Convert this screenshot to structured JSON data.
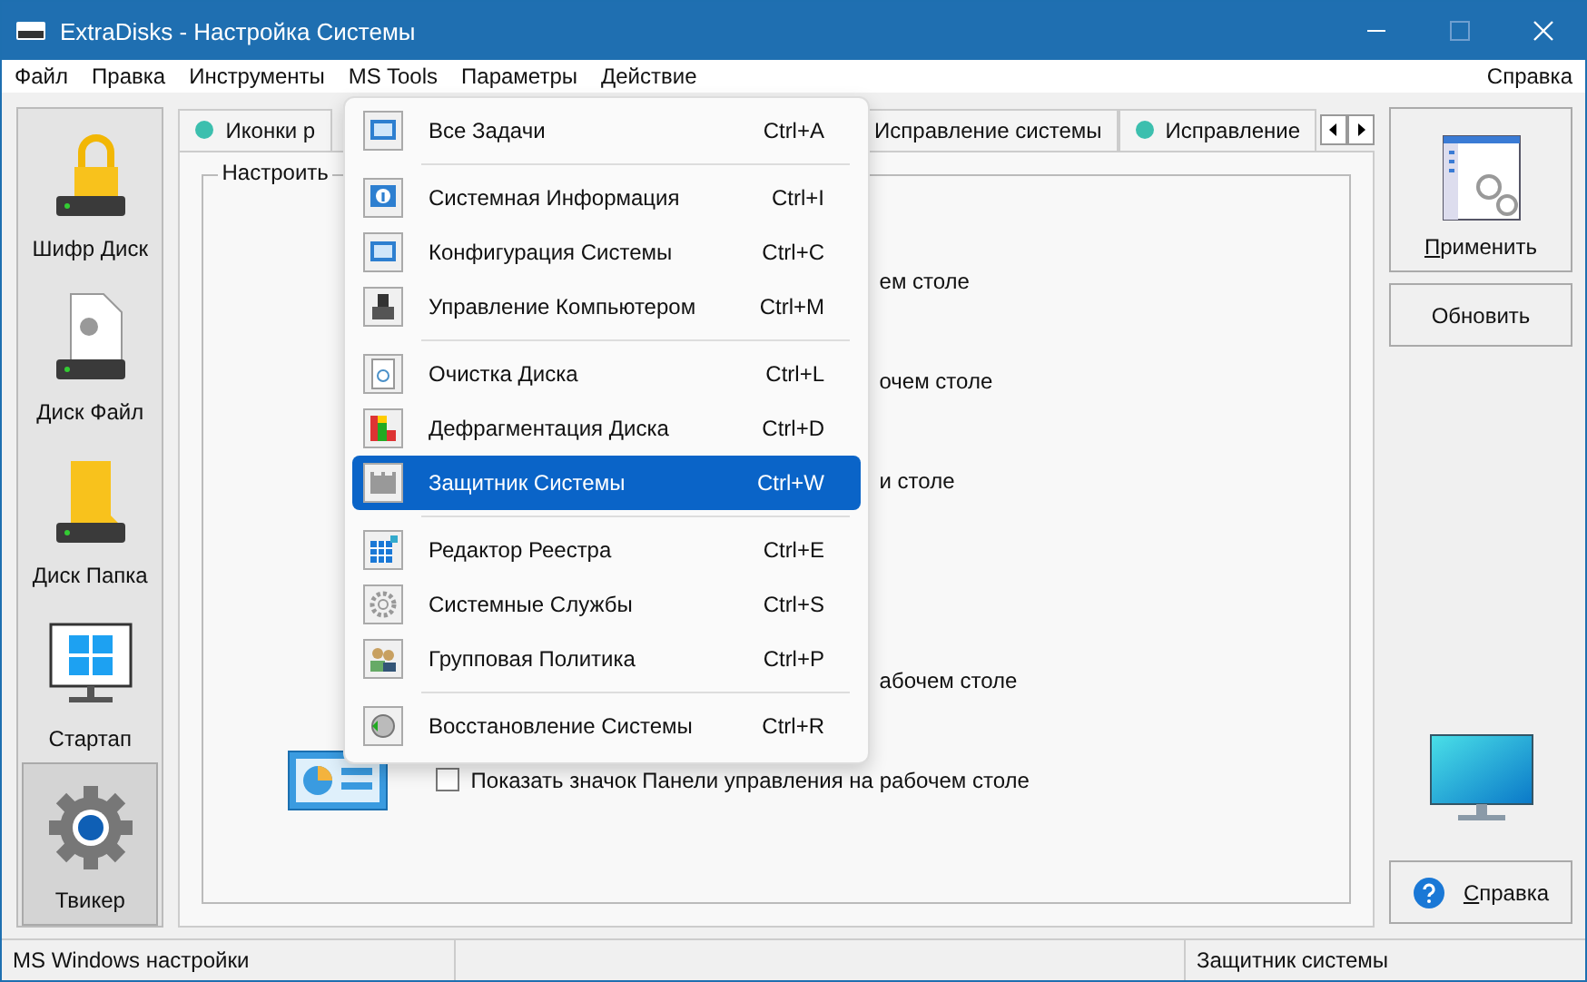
{
  "window": {
    "title": "ExtraDisks - Настройка Системы"
  },
  "menu_bar": {
    "items": [
      "Файл",
      "Правка",
      "Инструменты",
      "MS Tools",
      "Параметры",
      "Действие"
    ],
    "help": "Справка"
  },
  "sidebar": {
    "items": [
      {
        "label": "Шифр Диск",
        "kind": "lock",
        "selected": false
      },
      {
        "label": "Диск Файл",
        "kind": "file",
        "selected": false
      },
      {
        "label": "Диск Папка",
        "kind": "folder",
        "selected": false
      },
      {
        "label": "Стартап",
        "kind": "monitor",
        "selected": false
      },
      {
        "label": "Твикер",
        "kind": "gear",
        "selected": true
      }
    ]
  },
  "tabs": [
    {
      "label": "Иконки р"
    },
    {
      "label": "Исправление системы"
    },
    {
      "label": "Исправление"
    }
  ],
  "group": {
    "title": "Настроить",
    "rows": [
      {
        "text": "ем столе"
      },
      {
        "text": "очем столе"
      },
      {
        "text": "и столе"
      },
      {
        "text": "абочем столе"
      },
      {
        "text": "Показать значок Панели управления на рабочем столе",
        "checked": false
      }
    ]
  },
  "dropdown": [
    {
      "kind": "item",
      "label": "Все Задачи",
      "shortcut": "Ctrl+A",
      "selected": false
    },
    {
      "kind": "separator"
    },
    {
      "kind": "item",
      "label": "Системная Информация",
      "shortcut": "Ctrl+I",
      "selected": false
    },
    {
      "kind": "item",
      "label": "Конфигурация Системы",
      "shortcut": "Ctrl+C",
      "selected": false
    },
    {
      "kind": "item",
      "label": "Управление Компьютером",
      "shortcut": "Ctrl+M",
      "selected": false
    },
    {
      "kind": "separator"
    },
    {
      "kind": "item",
      "label": "Очистка Диска",
      "shortcut": "Ctrl+L",
      "selected": false
    },
    {
      "kind": "item",
      "label": "Дефрагментация Диска",
      "shortcut": "Ctrl+D",
      "selected": false
    },
    {
      "kind": "item",
      "label": "Защитник Системы",
      "shortcut": "Ctrl+W",
      "selected": true
    },
    {
      "kind": "separator"
    },
    {
      "kind": "item",
      "label": "Редактор Реестра",
      "shortcut": "Ctrl+E",
      "selected": false
    },
    {
      "kind": "item",
      "label": "Системные Службы",
      "shortcut": "Ctrl+S",
      "selected": false
    },
    {
      "kind": "item",
      "label": "Групповая Политика",
      "shortcut": "Ctrl+P",
      "selected": false
    },
    {
      "kind": "separator"
    },
    {
      "kind": "item",
      "label": "Восстановление Системы",
      "shortcut": "Ctrl+R",
      "selected": false
    }
  ],
  "actions": {
    "apply": "Применить",
    "refresh": "Обновить",
    "help": "Справка"
  },
  "status_bar": {
    "left": "MS Windows настройки",
    "right": "Защитник системы"
  }
}
